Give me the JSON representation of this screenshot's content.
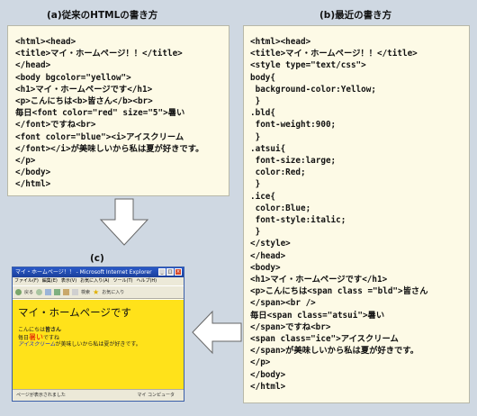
{
  "title_a": "(a)従来のHTMLの書き方",
  "title_b": "(b)最近の書き方",
  "title_c": "(c)",
  "code_a": [
    "<html><head>",
    "<title>マイ・ホームページ！！</title>",
    "</head>",
    "<body bgcolor=\"yellow\">",
    "<h1>マイ・ホームページです</h1>",
    "<p>こんにちは<b>皆さん</b><br>",
    "毎日<font color=\"red\" size=\"5\">暑い",
    "</font>ですね<br>",
    "<font color=\"blue\"><i>アイスクリーム",
    "</font></i>が美味しいから私は夏が好きです。",
    "</p>",
    "</body>",
    "</html>"
  ],
  "code_b": [
    "<html><head>",
    "<title>マイ・ホームページ！！</title>",
    "<style type=\"text/css\">",
    "body{",
    " background-color:Yellow;",
    " }",
    ".bld{",
    " font-weight:900;",
    " }",
    ".atsui{",
    " font-size:large;",
    " color:Red;",
    " }",
    ".ice{",
    " color:Blue;",
    " font-style:italic;",
    " }",
    "</style>",
    "</head>",
    "<body>",
    "<h1>マイ・ホームページです</h1>",
    "<p>こんにちは<span class =\"bld\">皆さん",
    "</span><br />",
    "毎日<span class=\"atsui\">暑い",
    "</span>ですね<br>",
    "<span class=\"ice\">アイスクリーム",
    "</span>が美味しいから私は夏が好きです。",
    "</p>",
    "</body>",
    "</html>"
  ],
  "browser": {
    "window_title": "マイ・ホームページ！！ - Microsoft Internet Explorer",
    "menu": [
      "ファイル(F)",
      "編集(E)",
      "表示(V)",
      "お気に入り(A)",
      "ツール(T)",
      "ヘルプ(H)"
    ],
    "toolbar_back": "戻る",
    "toolbar_search": "検索",
    "toolbar_favorites": "お気に入り",
    "content": {
      "heading": "マイ・ホームページです",
      "line1_prefix": "こんにちは",
      "line1_bold": "皆さん",
      "line2_prefix": "毎日",
      "line2_red": "暑い",
      "line2_suffix": "ですね",
      "line3_blue": "アイスクリーム",
      "line3_suffix": "が美味しいから私は夏が好きです。"
    },
    "status_left": "ページが表示されました",
    "status_right": "マイ コンピュータ"
  }
}
